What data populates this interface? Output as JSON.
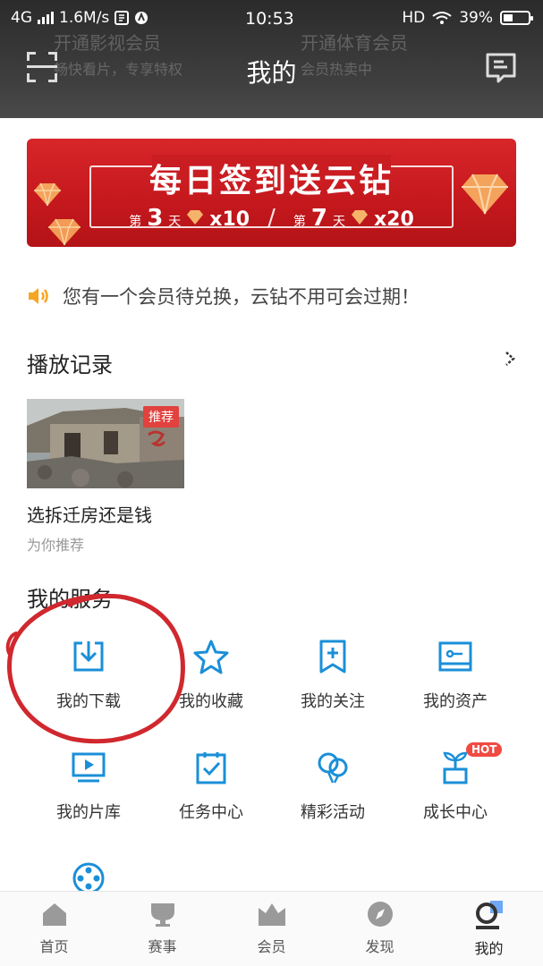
{
  "status_bar": {
    "network": "4G",
    "speed": "1.6M/s",
    "time": "10:53",
    "hd": "HD",
    "battery": "39%",
    "battery_level": 0.39
  },
  "header": {
    "title": "我的",
    "promo_left_title": "开通影视会员",
    "promo_left_sub": "畅快看片，专享特权",
    "promo_right_title": "开通体育会员",
    "promo_right_sub": "会员热卖中"
  },
  "banner": {
    "title": "每日签到送云钻",
    "day1_prefix": "第",
    "day1_num": "3",
    "day1_suffix": "天",
    "reward1": "x10",
    "divider": "/",
    "day2_prefix": "第",
    "day2_num": "7",
    "day2_suffix": "天",
    "reward2": "x20",
    "colors": {
      "bg": "#d8262a",
      "gem": "#f4a35c"
    }
  },
  "notice": {
    "text": "您有一个会员待兑换，云钻不用可会过期！",
    "icon": "speaker-icon",
    "icon_color": "#f5a623"
  },
  "playback": {
    "title": "播放记录",
    "items": [
      {
        "tag": "推荐",
        "title": "选拆迁房还是钱",
        "subtitle": "为你推荐"
      }
    ]
  },
  "services": {
    "title": "我的服务",
    "accent": "#1a8fd8",
    "items": [
      {
        "label": "我的下载",
        "icon": "download-icon"
      },
      {
        "label": "我的收藏",
        "icon": "star-icon"
      },
      {
        "label": "我的关注",
        "icon": "bookmark-plus-icon"
      },
      {
        "label": "我的资产",
        "icon": "wallet-icon"
      },
      {
        "label": "我的片库",
        "icon": "tv-play-icon"
      },
      {
        "label": "任务中心",
        "icon": "clipboard-check-icon"
      },
      {
        "label": "精彩活动",
        "icon": "balloon-icon"
      },
      {
        "label": "成长中心",
        "icon": "sprout-icon",
        "badge": "HOT"
      },
      {
        "label": "",
        "icon": "film-reel-icon"
      }
    ]
  },
  "bottom_nav": {
    "items": [
      {
        "label": "首页",
        "icon": "home-icon"
      },
      {
        "label": "赛事",
        "icon": "cup-icon"
      },
      {
        "label": "会员",
        "icon": "crown-icon"
      },
      {
        "label": "发现",
        "icon": "compass-icon"
      },
      {
        "label": "我的",
        "icon": "profile-icon",
        "active": true
      }
    ]
  },
  "annotation": {
    "color": "#d0282e"
  }
}
